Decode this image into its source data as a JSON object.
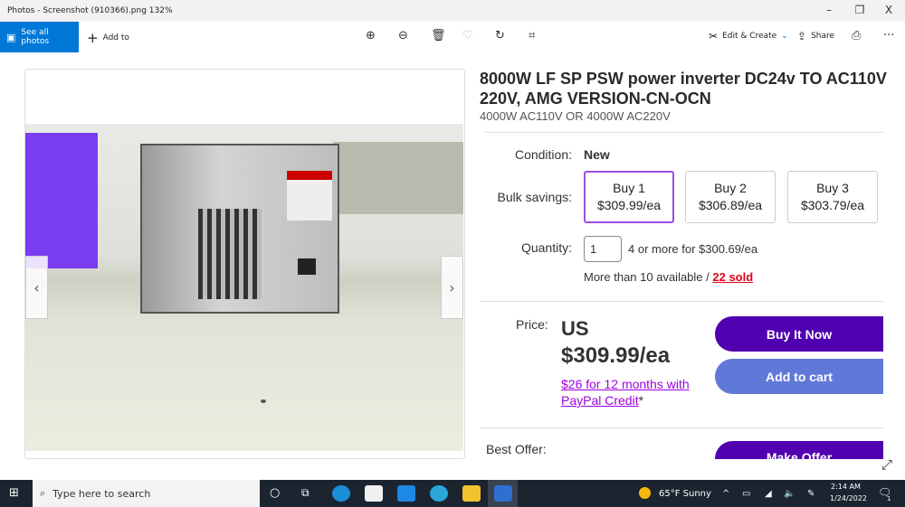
{
  "window": {
    "title": "Photos - Screenshot (910366).png   132%",
    "minimize": "–",
    "restore": "❐",
    "close": "X"
  },
  "toolbar": {
    "see_all_photos": "See all photos",
    "add_to": "Add to",
    "edit_create": "Edit & Create",
    "share": "Share",
    "more": "···",
    "icons": [
      "zoom-in-icon",
      "zoom-out-icon",
      "delete-icon",
      "heart-icon",
      "rotate-icon",
      "crop-icon",
      "print-icon"
    ]
  },
  "listing": {
    "title": "8000W LF SP PSW power inverter DC24v TO AC110V 220V, AMG VERSION-CN-OCN",
    "subtitle": "4000W AC110V OR 4000W AC220V",
    "condition_label": "Condition:",
    "condition": "New",
    "bulk_label": "Bulk savings:",
    "bulk": [
      {
        "qty": "Buy 1",
        "price": "$309.99/ea",
        "selected": true
      },
      {
        "qty": "Buy 2",
        "price": "$306.89/ea"
      },
      {
        "qty": "Buy 3",
        "price": "$303.79/ea"
      }
    ],
    "quantity_label": "Quantity:",
    "quantity": "1",
    "quantity_deal": "4 or more for $300.69/ea",
    "availability": "More than 10 available / ",
    "sold": "22 sold",
    "price_label": "Price:",
    "price_currency": "US",
    "price": "$309.99/ea",
    "credit_link": "$26 for 12 months with PayPal Credit",
    "credit_mark": "*",
    "buy_now": "Buy It Now",
    "add_to_cart": "Add to cart",
    "best_offer_label": "Best Offer:",
    "make_offer": "Make Offer",
    "colors": {
      "buy_now": "#5100b0",
      "add_to_cart": "#6079d9",
      "link": "#a000e0",
      "sold": "#e0001a"
    }
  },
  "taskbar": {
    "search_placeholder": "Type here to search",
    "weather": "65°F  Sunny",
    "time": "2:14 AM",
    "date": "1/24/2022",
    "notifications": "1"
  }
}
